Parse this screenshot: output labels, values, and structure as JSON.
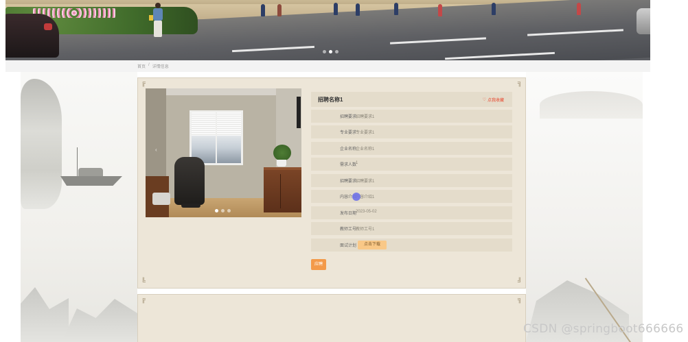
{
  "banner": {
    "carousel": {
      "slides": 3,
      "active_index": 1
    }
  },
  "breadcrumb": {
    "home": "首页",
    "separator": "/",
    "current": "详情信息"
  },
  "detail": {
    "title": "招聘名称1",
    "favorite_label": "点我收藏",
    "favorite_icon": "heart-icon",
    "fields": [
      {
        "label": "招聘要求",
        "value": "招聘要求1"
      },
      {
        "label": "专业要求",
        "value": "专业要求1"
      },
      {
        "label": "企业名称",
        "value": "企业名称1"
      },
      {
        "label": "需求人数",
        "value": "1"
      },
      {
        "label": "招聘要求",
        "value": "招聘要求1"
      },
      {
        "label": "内容介绍",
        "value": "内容介绍1"
      },
      {
        "label": "发布日期",
        "value": "2023-05-02"
      },
      {
        "label": "教师工号",
        "value": "教师工号1"
      }
    ],
    "plan": {
      "label": "面试计划",
      "button": "点击下载"
    },
    "apply_button": "应聘",
    "photo_carousel": {
      "slides": 3,
      "active_index": 0
    }
  },
  "watermark": "CSDN @springboot666666",
  "colors": {
    "panel": "#ede6d8",
    "row": "#e4dccb",
    "accent_orange": "#f39a4a",
    "favorite_red": "#e8442a",
    "download_button": "#f9c887"
  }
}
